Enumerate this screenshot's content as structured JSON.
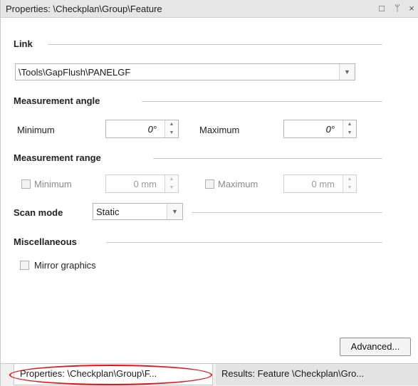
{
  "window": {
    "title": "Properties: \\Checkplan\\Group\\Feature",
    "controls": [
      "restore-icon",
      "pin-icon",
      "close-icon"
    ]
  },
  "link": {
    "section_label": "Link",
    "path_value": "\\Tools\\GapFlush\\PANELGF"
  },
  "measurement_angle": {
    "section_label": "Measurement angle",
    "minimum_label": "Minimum",
    "minimum_value": "0°",
    "maximum_label": "Maximum",
    "maximum_value": "0°"
  },
  "measurement_range": {
    "section_label": "Measurement range",
    "minimum_label": "Minimum",
    "minimum_value": "0 mm",
    "minimum_checked": false,
    "maximum_label": "Maximum",
    "maximum_value": "0 mm",
    "maximum_checked": false
  },
  "scan_mode": {
    "label": "Scan mode",
    "value": "Static"
  },
  "miscellaneous": {
    "section_label": "Miscellaneous",
    "mirror_graphics_label": "Mirror graphics",
    "mirror_graphics_checked": false
  },
  "advanced_button_label": "Advanced...",
  "tabs": [
    {
      "label": "Properties: \\Checkplan\\Group\\F...",
      "active": true
    },
    {
      "label": "Results: Feature \\Checkplan\\Gro...",
      "active": false
    }
  ],
  "icons": {
    "restore": "□",
    "pin": "ᛘ",
    "close": "×",
    "dropdown": "▼",
    "spin_up": "▲",
    "spin_down": "▼"
  },
  "annotation_color": "#e3141b"
}
